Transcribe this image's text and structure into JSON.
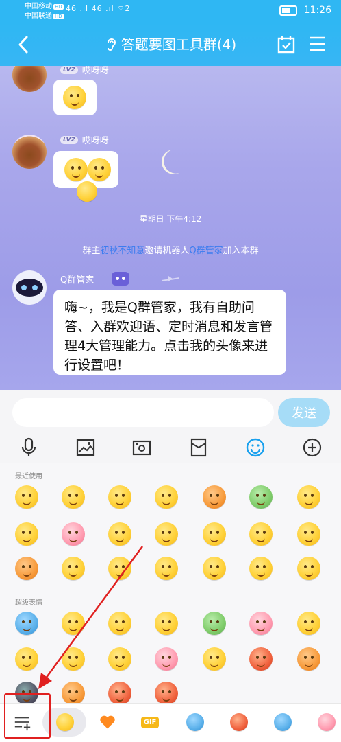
{
  "status_bar": {
    "carrier1": "中国移动",
    "carrier2": "中国联通",
    "hd": "HD",
    "signal": "46 .ıl 46 .ıl ⌔2",
    "time": "11:26"
  },
  "header": {
    "title": "答题要图工具群(4)"
  },
  "messages": [
    {
      "sender": "哎呀呀",
      "level": "LV2",
      "content": "😂"
    },
    {
      "sender": "哎呀呀",
      "level": "LV2",
      "content": "😌😌"
    }
  ],
  "timestamp": "星期日 下午4:12",
  "system_message": {
    "prefix": "群主",
    "owner": "初秋不知意",
    "middle": "邀请机器人",
    "bot": "Q群管家",
    "suffix": "加入本群"
  },
  "bot_message": {
    "sender": "Q群管家",
    "text": "嗨~，我是Q群管家，我有自助问答、入群欢迎语、定时消息和发言管理4大管理能力。点击我的头像来进行设置吧！"
  },
  "input": {
    "placeholder": "",
    "send_label": "发送"
  },
  "emoji_panel": {
    "recent_label": "最近使用",
    "super_label": "超级表情"
  },
  "bottom_bar": {
    "gif_label": "GIF"
  },
  "colors": {
    "header": "#2fb7f3",
    "send_button": "#a6dcf7",
    "annotation": "#e02020"
  }
}
